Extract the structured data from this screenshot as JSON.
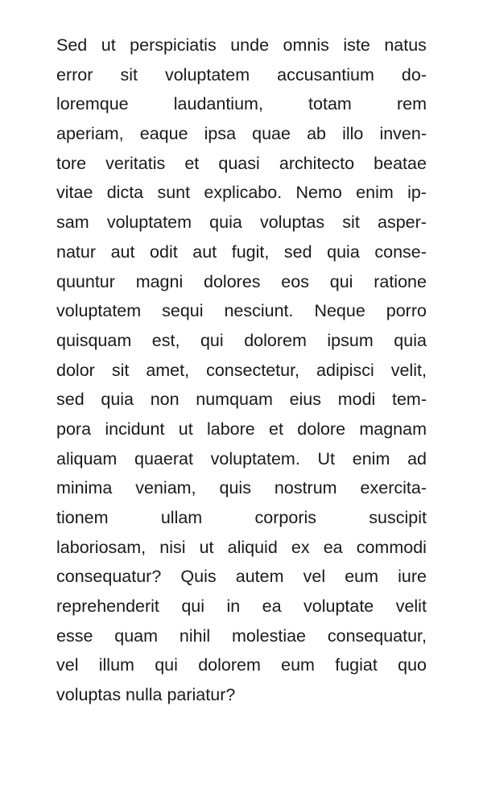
{
  "document": {
    "paragraph_lines": [
      "Sed ut perspiciatis unde omnis iste natus",
      "error sit voluptatem accusantium do-",
      "loremque laudantium, totam rem",
      "aperiam, eaque ipsa quae ab illo inven-",
      "tore veritatis et quasi architecto beatae",
      "vitae dicta sunt explicabo. Nemo enim ip-",
      "sam voluptatem quia voluptas sit asper-",
      "natur aut odit aut fugit, sed quia conse-",
      "quuntur magni dolores eos qui ratione",
      "voluptatem sequi nesciunt. Neque porro",
      "quisquam est, qui dolorem ipsum quia",
      "dolor sit amet, consectetur, adipisci velit,",
      "sed quia non numquam eius modi tem-",
      "pora incidunt ut labore et dolore magnam",
      "aliquam quaerat voluptatem. Ut enim ad",
      "minima veniam, quis nostrum exercita-",
      "tionem ullam corporis suscipit",
      "laboriosam, nisi ut aliquid ex ea commodi",
      "consequatur? Quis autem vel eum iure",
      "reprehenderit qui in ea voluptate velit",
      "esse quam nihil molestiae consequatur,",
      "vel illum qui dolorem eum fugiat quo",
      "voluptas nulla pariatur?"
    ]
  }
}
